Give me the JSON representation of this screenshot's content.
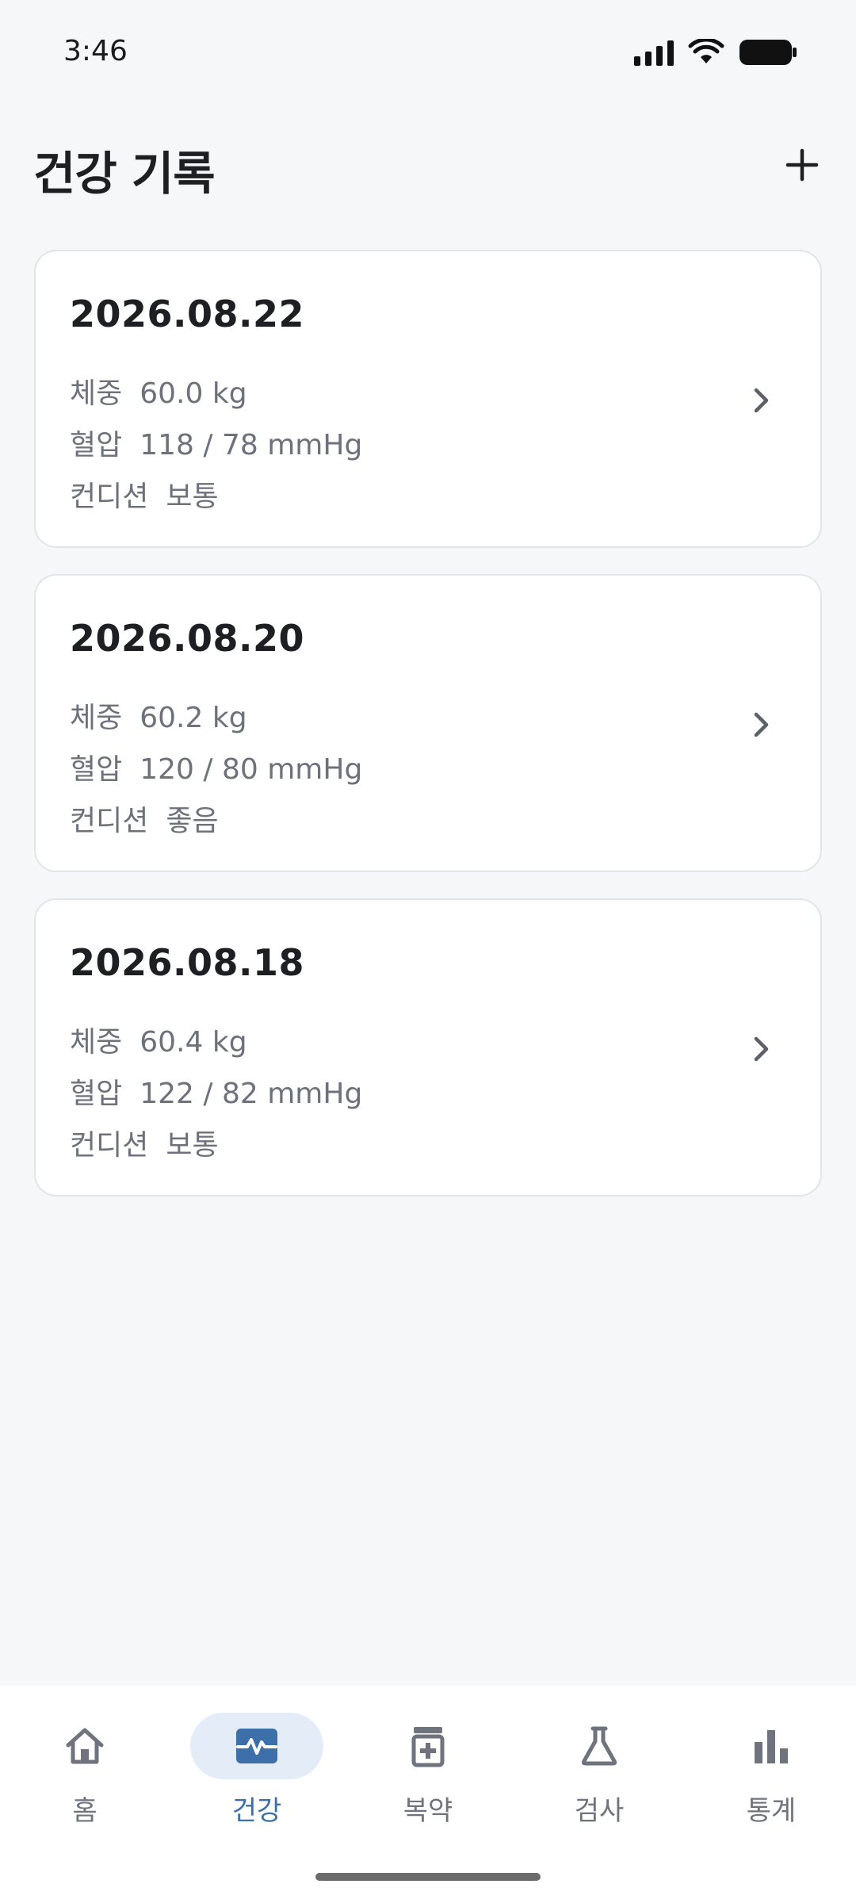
{
  "status_bar": {
    "time": "3:46"
  },
  "header": {
    "title": "건강 기록"
  },
  "records": [
    {
      "date": "2026.08.22",
      "weight_label": "체중",
      "weight_value": "60.0 kg",
      "bp_label": "혈압",
      "bp_value": "118 / 78 mmHg",
      "condition_label": "컨디션",
      "condition_value": "보통"
    },
    {
      "date": "2026.08.20",
      "weight_label": "체중",
      "weight_value": "60.2 kg",
      "bp_label": "혈압",
      "bp_value": "120 / 80 mmHg",
      "condition_label": "컨디션",
      "condition_value": "좋음"
    },
    {
      "date": "2026.08.18",
      "weight_label": "체중",
      "weight_value": "60.4 kg",
      "bp_label": "혈압",
      "bp_value": "122 / 82 mmHg",
      "condition_label": "컨디션",
      "condition_value": "보통"
    }
  ],
  "nav": [
    {
      "label": "홈",
      "icon": "home-icon",
      "active": false
    },
    {
      "label": "건강",
      "icon": "heart-pulse-icon",
      "active": true
    },
    {
      "label": "복약",
      "icon": "medicine-icon",
      "active": false
    },
    {
      "label": "검사",
      "icon": "flask-icon",
      "active": false
    },
    {
      "label": "통계",
      "icon": "bar-chart-icon",
      "active": false
    }
  ],
  "colors": {
    "accent": "#3d6fa8",
    "active_nav_bg": "#e4edf7",
    "background": "#f6f7f9",
    "muted_text": "#6c717c"
  }
}
